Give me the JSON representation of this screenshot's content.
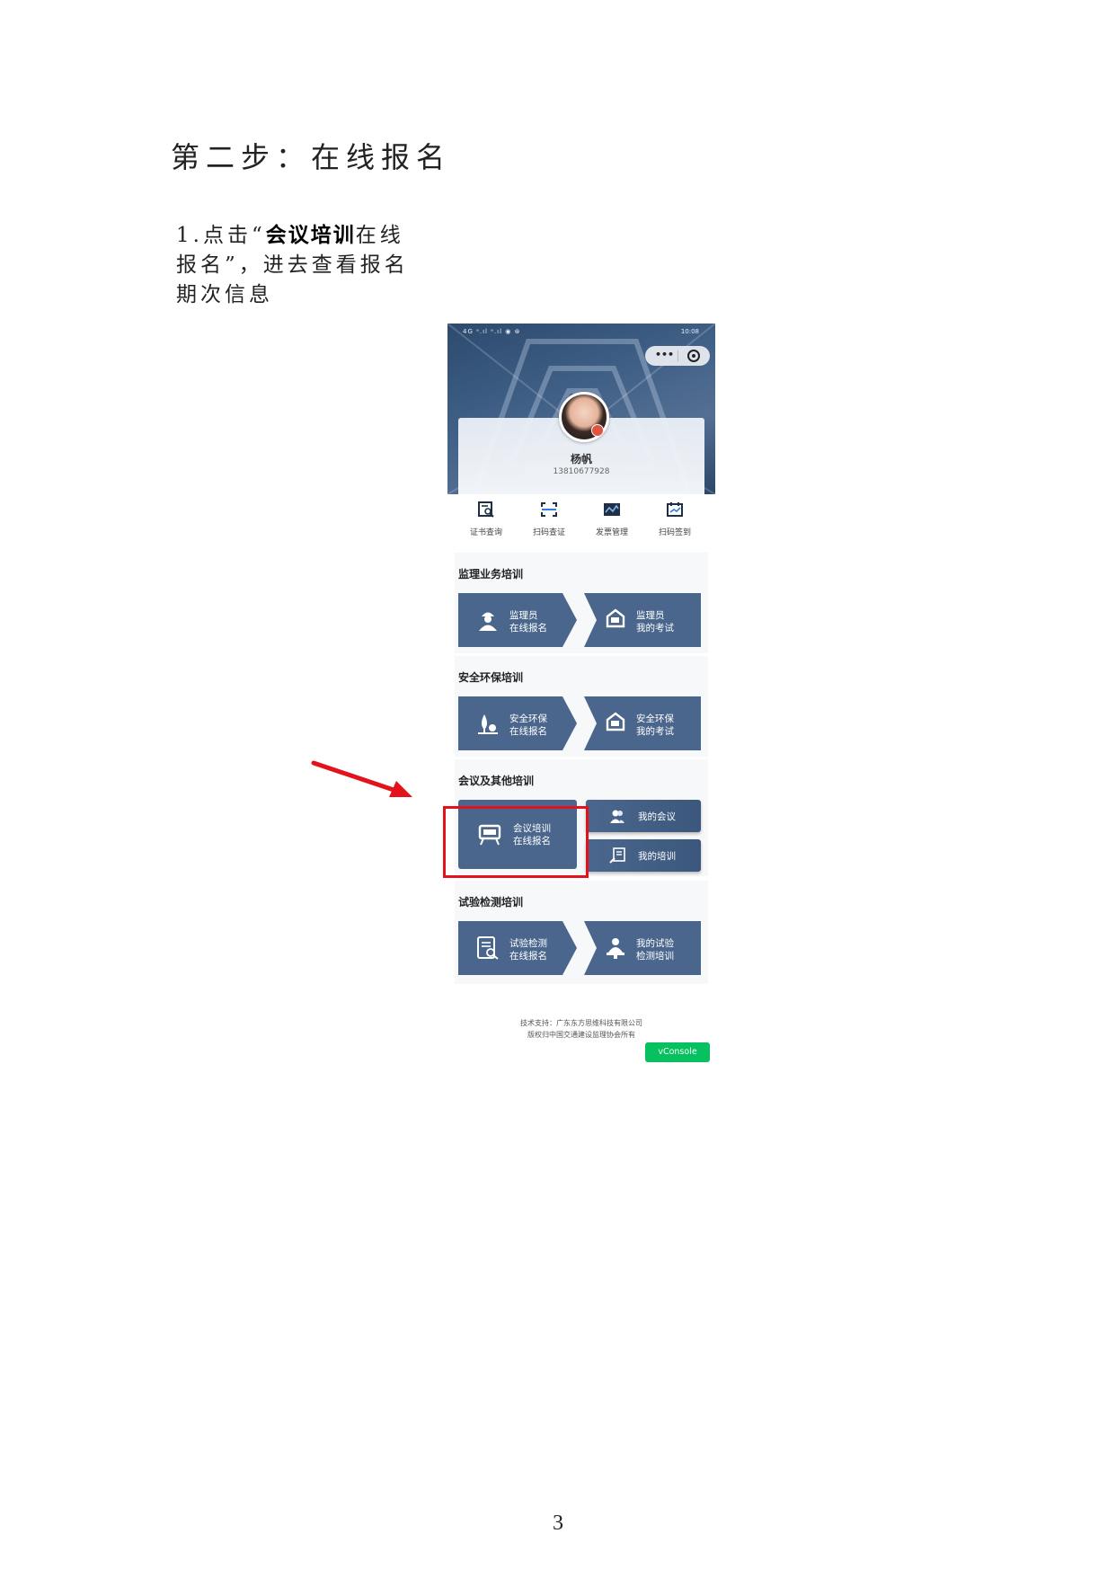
{
  "document": {
    "heading": "第二步：在线报名",
    "step": {
      "prefix": "1.点击“",
      "bold": "会议培训",
      "suffix": "在线报名”，进去查看报名期次信息"
    },
    "page_number": "3"
  },
  "phone": {
    "status_left": "4G ᵃ.ıl ᵃ.ıl ◉ ⊛",
    "status_time": "10:08",
    "user": {
      "name": "杨帆",
      "phone": "13810677928"
    },
    "quick_actions": [
      {
        "label": "证书查询",
        "icon": "certificate-search-icon"
      },
      {
        "label": "扫码查证",
        "icon": "scan-verify-icon"
      },
      {
        "label": "发票管理",
        "icon": "invoice-icon"
      },
      {
        "label": "扫码签到",
        "icon": "scan-checkin-icon"
      }
    ],
    "sections": [
      {
        "title": "监理业务培训",
        "tiles": [
          {
            "line1": "监理员",
            "line2": "在线报名",
            "icon": "worker-icon"
          },
          {
            "line1": "监理员",
            "line2": "我的考试",
            "icon": "exam-pen-icon"
          }
        ]
      },
      {
        "title": "安全环保培训",
        "tiles": [
          {
            "line1": "安全环保",
            "line2": "在线报名",
            "icon": "tree-icon"
          },
          {
            "line1": "安全环保",
            "line2": "我的考试",
            "icon": "exam-pen-icon"
          }
        ]
      },
      {
        "title": "会议及其他培训",
        "main_tile": {
          "line1": "会议培训",
          "line2": "在线报名",
          "icon": "presentation-board-icon"
        },
        "small_tiles": [
          {
            "label": "我的会议",
            "icon": "people-icon"
          },
          {
            "label": "我的培训",
            "icon": "training-doc-icon"
          }
        ]
      },
      {
        "title": "试验检测培训",
        "tiles": [
          {
            "line1": "试验检测",
            "line2": "在线报名",
            "icon": "report-search-icon"
          },
          {
            "line1": "我的试验",
            "line2": "检测培训",
            "icon": "lecturer-icon"
          }
        ]
      }
    ],
    "footer": {
      "line1": "技术支持：广东东方思维科技有限公司",
      "line2": "版权归中国交通建设监理协会所有"
    },
    "vconsole_label": "vConsole"
  },
  "colors": {
    "tile": "#4a668c",
    "highlight": "#e3121b",
    "arrow": "#e3121b",
    "vconsole": "#07c160"
  }
}
